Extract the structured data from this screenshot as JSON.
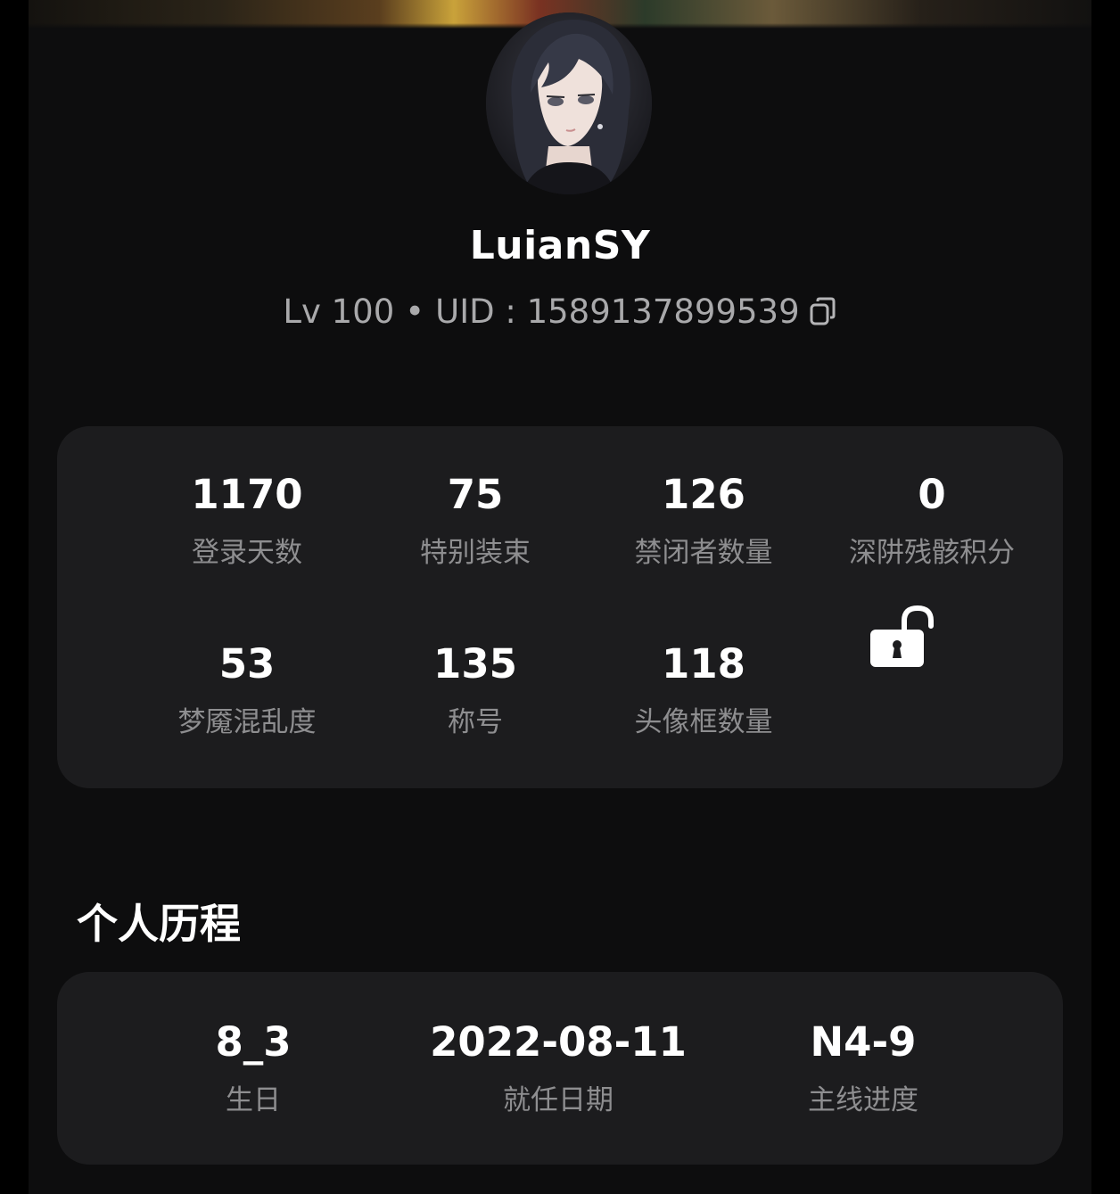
{
  "profile": {
    "username": "LuianSY",
    "level": "Lv 100",
    "separator": "•",
    "uid": "UID : 1589137899539"
  },
  "stats": [
    {
      "value": "1170",
      "label": "登录天数"
    },
    {
      "value": "75",
      "label": "特别装束"
    },
    {
      "value": "126",
      "label": "禁闭者数量"
    },
    {
      "value": "0",
      "label": "深阱残骸积分"
    },
    {
      "value": "53",
      "label": "梦魇混乱度"
    },
    {
      "value": "135",
      "label": "称号"
    },
    {
      "value": "118",
      "label": "头像框数量"
    }
  ],
  "history": {
    "title": "个人历程",
    "items": [
      {
        "value": "8_3",
        "label": "生日"
      },
      {
        "value": "2022-08-11",
        "label": "就任日期"
      },
      {
        "value": "N4-9",
        "label": "主线进度"
      }
    ]
  },
  "icons": {
    "copy": "copy-icon",
    "lock": "unlock-icon"
  }
}
